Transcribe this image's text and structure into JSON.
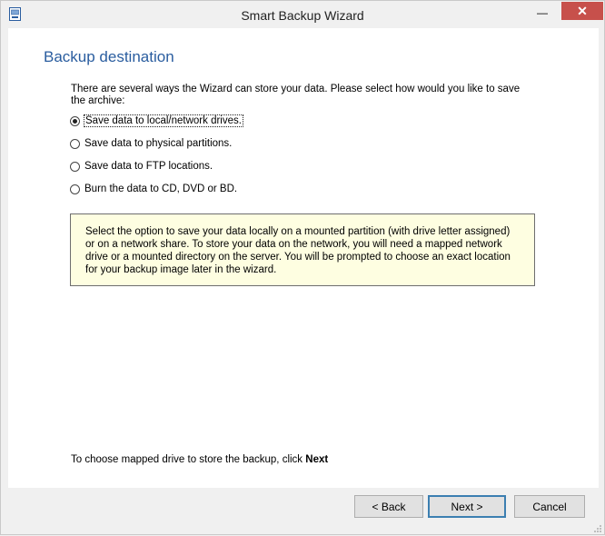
{
  "window": {
    "title": "Smart Backup Wizard",
    "minimize_glyph": "—",
    "close_glyph": "✕",
    "icon": "app-icon"
  },
  "page": {
    "title": "Backup destination",
    "intro": "There are several ways the Wizard can store your data. Please select how would you like to save the archive:"
  },
  "options": [
    {
      "label": "Save data to local/network drives.",
      "selected": true
    },
    {
      "label": "Save data to physical partitions.",
      "selected": false
    },
    {
      "label": "Save data to FTP locations.",
      "selected": false
    },
    {
      "label": "Burn the data to CD, DVD or BD.",
      "selected": false
    }
  ],
  "info": {
    "text": "Select the option to save your data locally on a mounted partition (with drive letter assigned) or on a network share. To store your data on the network, you will need a mapped network drive or a mounted directory on the server. You will be prompted to choose an exact location for your backup image later in the wizard."
  },
  "hint": {
    "prefix": "To choose mapped drive to store the backup, click ",
    "action": "Next"
  },
  "buttons": {
    "back": "< Back",
    "next": "Next >",
    "cancel": "Cancel"
  },
  "colors": {
    "title_blue": "#2a5d9f",
    "close_red": "#c7504b",
    "info_bg": "#fefee1"
  }
}
